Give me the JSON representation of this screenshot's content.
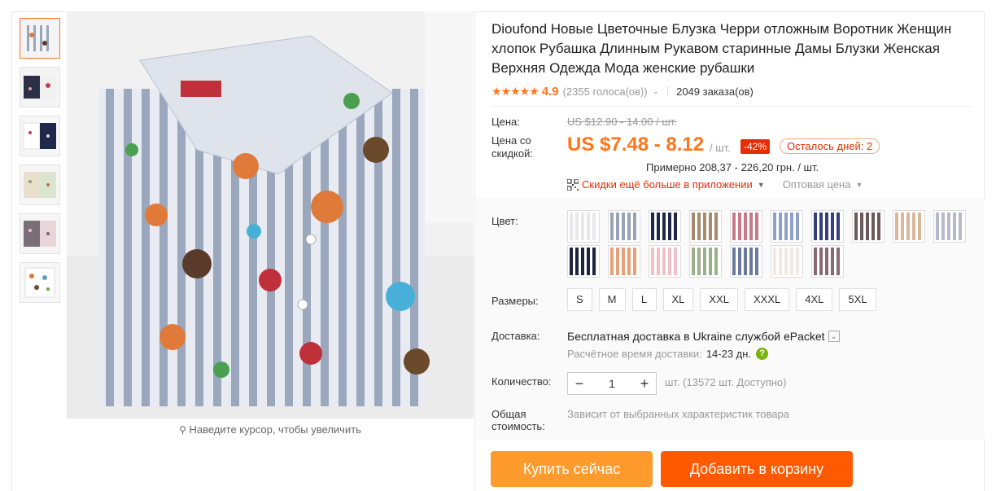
{
  "thumbnails": [
    {
      "colors": [
        "#dfe3ea",
        "#7a8fb0"
      ]
    },
    {
      "colors": [
        "#2a2f45",
        "#a05060"
      ]
    },
    {
      "colors": [
        "#ffffff",
        "#2b3b6b"
      ]
    },
    {
      "colors": [
        "#e9dfcd",
        "#8aa070"
      ]
    },
    {
      "colors": [
        "#7a6e78",
        "#c9a0a8"
      ]
    },
    {
      "colors": [
        "#f4f4f4",
        "#e07a3a"
      ]
    }
  ],
  "zoom_hint": "Наведите курсор, чтобы увеличить",
  "title": "Dioufond Новые Цветочные Блузка Черри отложным Воротник Женщин хлопок Рубашка Длинным Рукавом старинные Дамы Блузки Женская Верхняя Одежда Мода женские рубашки",
  "rating": {
    "stars": "★★★★★",
    "value": "4.9",
    "votes": "(2355 голоса(ов))",
    "orders": "2049 заказа(ов)"
  },
  "price": {
    "label": "Цена:",
    "old": "US $12.90 - 14.00 / шт.",
    "discount_label": "Цена со скидкой:",
    "new": "US $7.48 - 8.12",
    "per_unit": "/ шт.",
    "discount": "-42%",
    "days_left": "Осталось дней: 2",
    "approx": "Примерно 208,37 - 226,20 грн. / шт.",
    "app_discount": "Скидки ещё больше в приложении",
    "wholesale": "Оптовая цена"
  },
  "color": {
    "label": "Цвет:",
    "swatches": [
      "#e8e8ec",
      "#9aa3b5",
      "#1f2848",
      "#a88a6c",
      "#c97a8a",
      "#8fa0c8",
      "#35407a",
      "#6d5a5e",
      "#d9b89a",
      "#b7b9c9",
      "#1d2340",
      "#e7a07a",
      "#f0c0c8",
      "#9bb08a",
      "#6a7a9a",
      "#f2e8e4",
      "#8a6a72"
    ]
  },
  "sizes": {
    "label": "Размеры:",
    "items": [
      "S",
      "M",
      "L",
      "XL",
      "XXL",
      "XXXL",
      "4XL",
      "5XL"
    ]
  },
  "shipping": {
    "label": "Доставка:",
    "main": "Бесплатная доставка в Ukraine службой ePacket",
    "estimate_label": "Расчётное время доставки:",
    "estimate_days": "14-23 дн."
  },
  "quantity": {
    "label": "Количество:",
    "value": "1",
    "stock": "шт. (13572 шт. Доступно)"
  },
  "total": {
    "label": "Общая стоимость:",
    "note": "Зависит от выбранных характеристик товара"
  },
  "buttons": {
    "buy": "Купить сейчас",
    "cart": "Добавить в корзину"
  },
  "accent": "#ff7519"
}
